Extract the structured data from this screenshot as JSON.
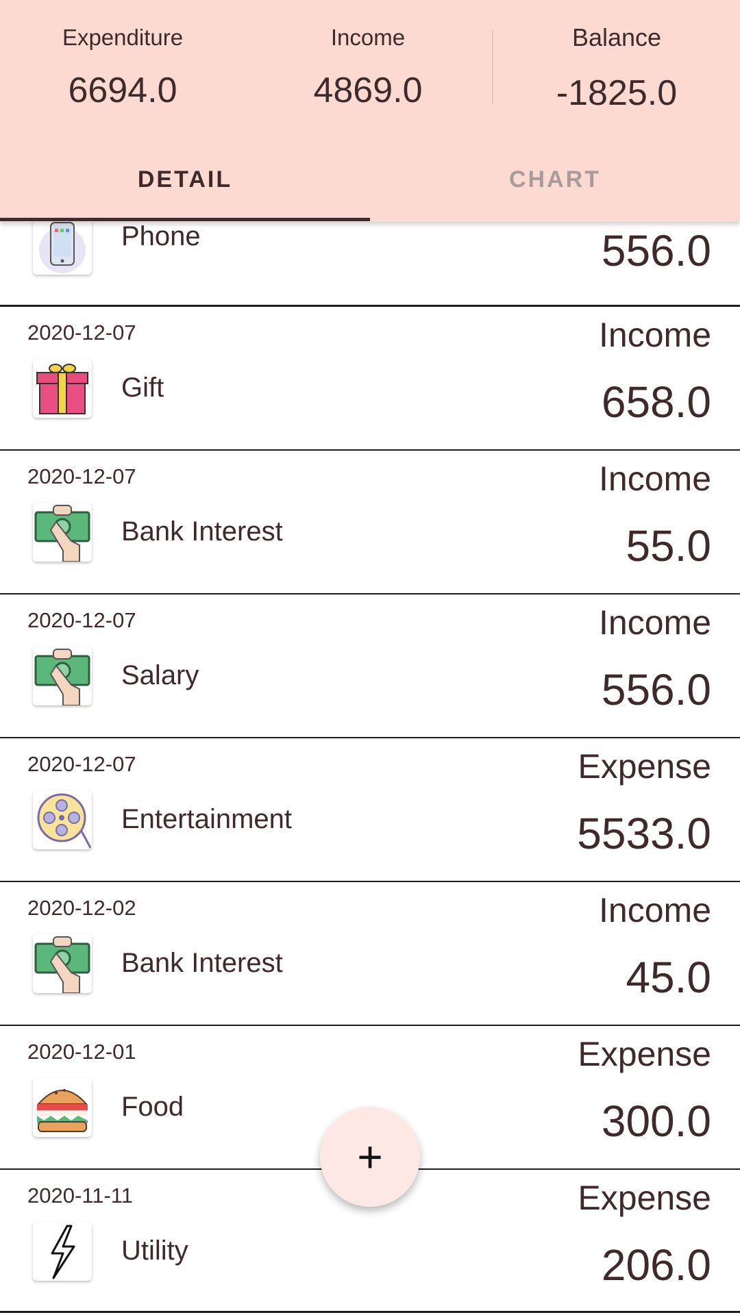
{
  "summary": {
    "expenditure_label": "Expenditure",
    "expenditure_value": "6694.0",
    "income_label": "Income",
    "income_value": "4869.0",
    "balance_label": "Balance",
    "balance_value": "-1825.0"
  },
  "tabs": [
    {
      "label": "DETAIL",
      "active": true
    },
    {
      "label": "CHART",
      "active": false
    }
  ],
  "transactions": [
    {
      "date": "",
      "category": "Phone",
      "type": "",
      "amount": "556.0",
      "icon": "phone-icon"
    },
    {
      "date": "2020-12-07",
      "category": "Gift",
      "type": "Income",
      "amount": "658.0",
      "icon": "gift-icon"
    },
    {
      "date": "2020-12-07",
      "category": "Bank Interest",
      "type": "Income",
      "amount": "55.0",
      "icon": "money-hand-icon"
    },
    {
      "date": "2020-12-07",
      "category": "Salary",
      "type": "Income",
      "amount": "556.0",
      "icon": "money-hand-icon"
    },
    {
      "date": "2020-12-07",
      "category": "Entertainment",
      "type": "Expense",
      "amount": "5533.0",
      "icon": "film-reel-icon"
    },
    {
      "date": "2020-12-02",
      "category": "Bank Interest",
      "type": "Income",
      "amount": "45.0",
      "icon": "money-hand-icon"
    },
    {
      "date": "2020-12-01",
      "category": "Food",
      "type": "Expense",
      "amount": "300.0",
      "icon": "burger-icon"
    },
    {
      "date": "2020-11-11",
      "category": "Utility",
      "type": "Expense",
      "amount": "206.0",
      "icon": "lightning-icon"
    }
  ],
  "fab": {
    "label": "+"
  },
  "colors": {
    "header_bg": "#fcdad2",
    "text": "#3e2a2a",
    "fab_bg": "#fde8e4"
  }
}
